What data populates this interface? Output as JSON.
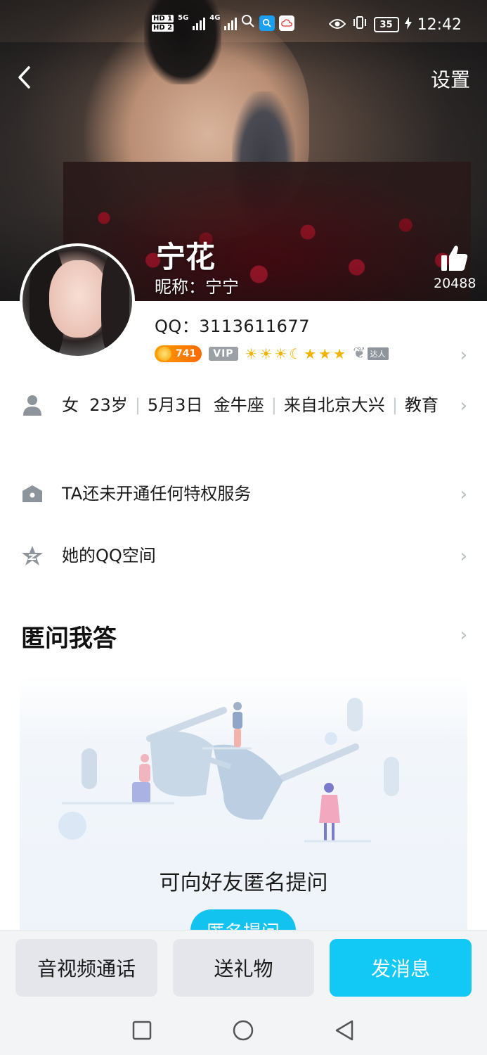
{
  "status_bar": {
    "hd1": "HD 1",
    "hd2": "HD 2",
    "net1": "5G",
    "net2": "4G",
    "battery": "35",
    "time": "12:42"
  },
  "header": {
    "settings_label": "设置"
  },
  "profile": {
    "name": "宁花",
    "nickname": "昵称：宁宁",
    "likes": "20488",
    "qq": "QQ：3113611677",
    "level_value": "741",
    "vip_label": "VIP",
    "daren_label": "达人"
  },
  "info": {
    "gender": "女",
    "age": "23岁",
    "birthday": "5月3日",
    "constellation": "金牛座",
    "location": "来自北京大兴",
    "occupation": "教育"
  },
  "privilege_text": "TA还未开通任何特权服务",
  "qzone_text": "她的QQ空间",
  "qa": {
    "title": "匿问我答",
    "hint": "可向好友匿名提问",
    "button": "匿名提问"
  },
  "bottom_actions": {
    "call": "音视频通话",
    "gift": "送礼物",
    "message": "发消息"
  },
  "colors": {
    "accent": "#12c8f5",
    "chevron": "#b7bcc2",
    "icon_gray": "#8e949b"
  }
}
